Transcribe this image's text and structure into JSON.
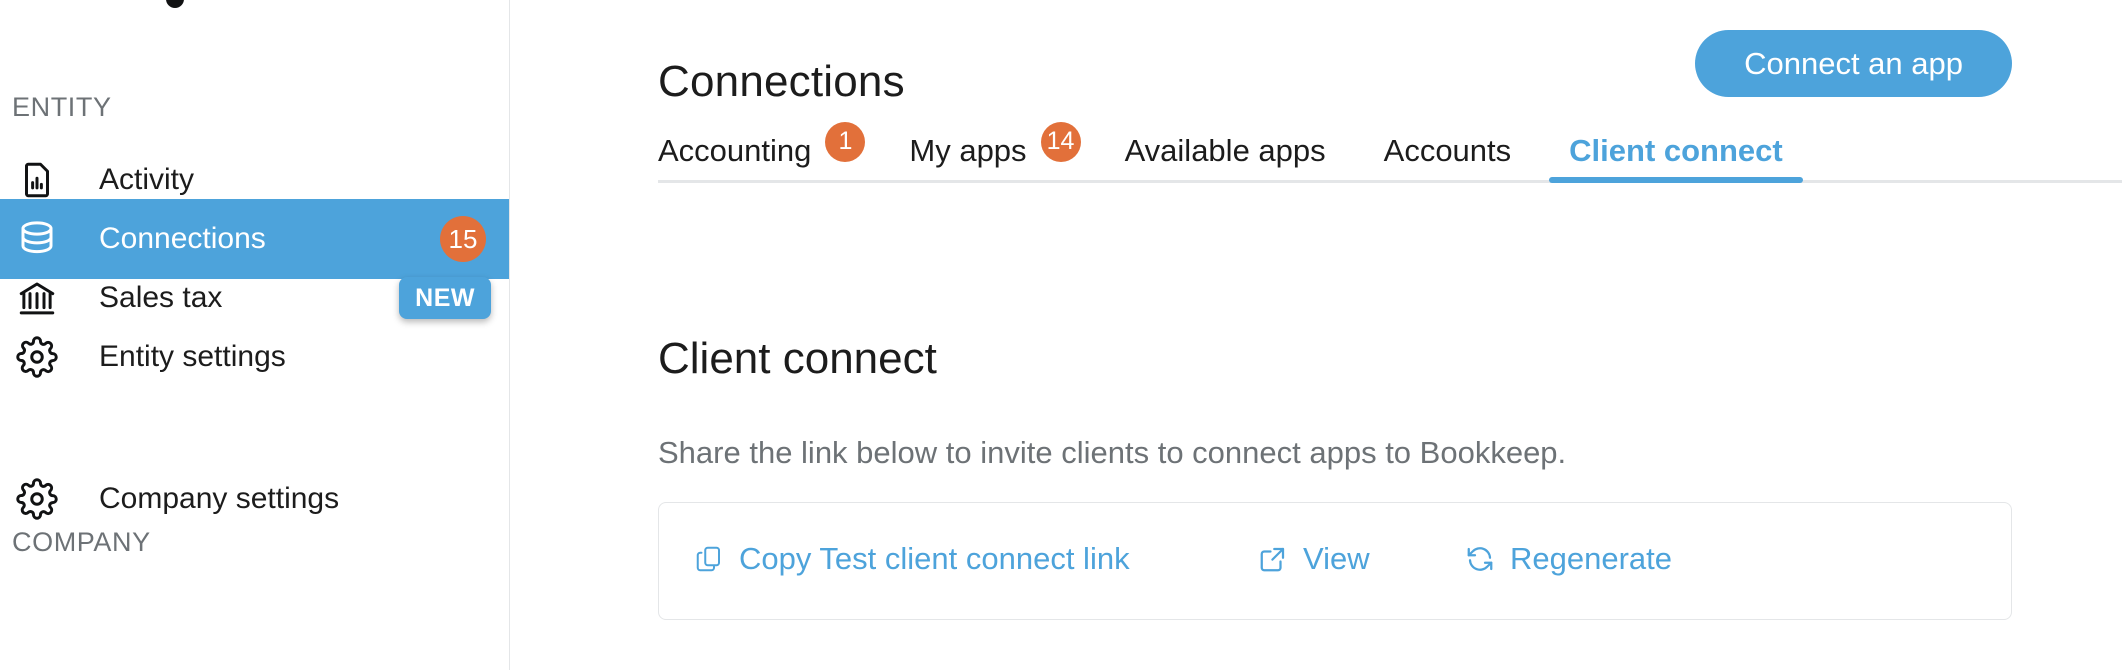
{
  "sidebar": {
    "logo": "bookkeep-logo-mark",
    "sections": [
      {
        "label": "ENTITY",
        "items": [
          {
            "label": "Activity",
            "icon": "document-chart-icon",
            "badge": null,
            "badge_type": null,
            "active": false
          },
          {
            "label": "Connections",
            "icon": "database-icon",
            "badge": "15",
            "badge_type": "count",
            "active": true
          },
          {
            "label": "Sales tax",
            "icon": "bank-icon",
            "badge": "NEW",
            "badge_type": "new",
            "active": false
          },
          {
            "label": "Entity settings",
            "icon": "gear-icon",
            "badge": null,
            "badge_type": null,
            "active": false
          }
        ]
      },
      {
        "label": "COMPANY",
        "items": [
          {
            "label": "Company settings",
            "icon": "gear-icon",
            "badge": null,
            "badge_type": null,
            "active": false
          }
        ]
      }
    ]
  },
  "header": {
    "title": "Connections",
    "primary_button": "Connect an app"
  },
  "tabs": [
    {
      "label": "Accounting",
      "badge": "1",
      "active": false
    },
    {
      "label": "My apps",
      "badge": "14",
      "active": false
    },
    {
      "label": "Available apps",
      "badge": null,
      "active": false
    },
    {
      "label": "Accounts",
      "badge": null,
      "active": false
    },
    {
      "label": "Client connect",
      "badge": null,
      "active": true
    }
  ],
  "content": {
    "heading": "Client connect",
    "description": "Share the link below to invite clients to connect apps to Bookkeep.",
    "card": {
      "copy_link": {
        "label": "Copy Test client connect link",
        "icon": "copy-icon"
      },
      "view_link": {
        "label": "View",
        "icon": "external-link-icon"
      },
      "regenerate_link": {
        "label": "Regenerate",
        "icon": "refresh-icon"
      }
    }
  },
  "colors": {
    "accent_blue": "#4da3db",
    "badge_orange": "#e2703a",
    "muted_text": "#6d7276",
    "border": "#e4e6e8"
  }
}
